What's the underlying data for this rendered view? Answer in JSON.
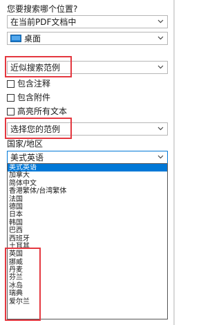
{
  "question": "您要搜索哪个位置?",
  "location": {
    "selected": "在当前PDF文档中"
  },
  "folder": {
    "selected": "桌面",
    "icon": "desktop-folder-icon"
  },
  "match": {
    "selected": "近似搜索范例"
  },
  "options": [
    {
      "label": "包含注释",
      "checked": false
    },
    {
      "label": "包含附件",
      "checked": false
    },
    {
      "label": "高亮所有文本",
      "checked": false
    }
  ],
  "scope": {
    "selected": "选择您的范例"
  },
  "region": {
    "label": "国家/地区",
    "selected": "美式英语",
    "list": [
      "美式英语",
      "加拿大",
      "简体中文",
      "香港繁体/台湾繁体",
      "法国",
      "德国",
      "日本",
      "韩国",
      "巴西",
      "西班牙",
      "土耳其",
      "英国",
      "挪威",
      "丹麦",
      "芬兰",
      "冰岛",
      "瑞典",
      "爱尔兰"
    ]
  },
  "colors": {
    "highlight": "#e4373f",
    "selection": "#0078d7",
    "folder": "#1e7fd1"
  }
}
